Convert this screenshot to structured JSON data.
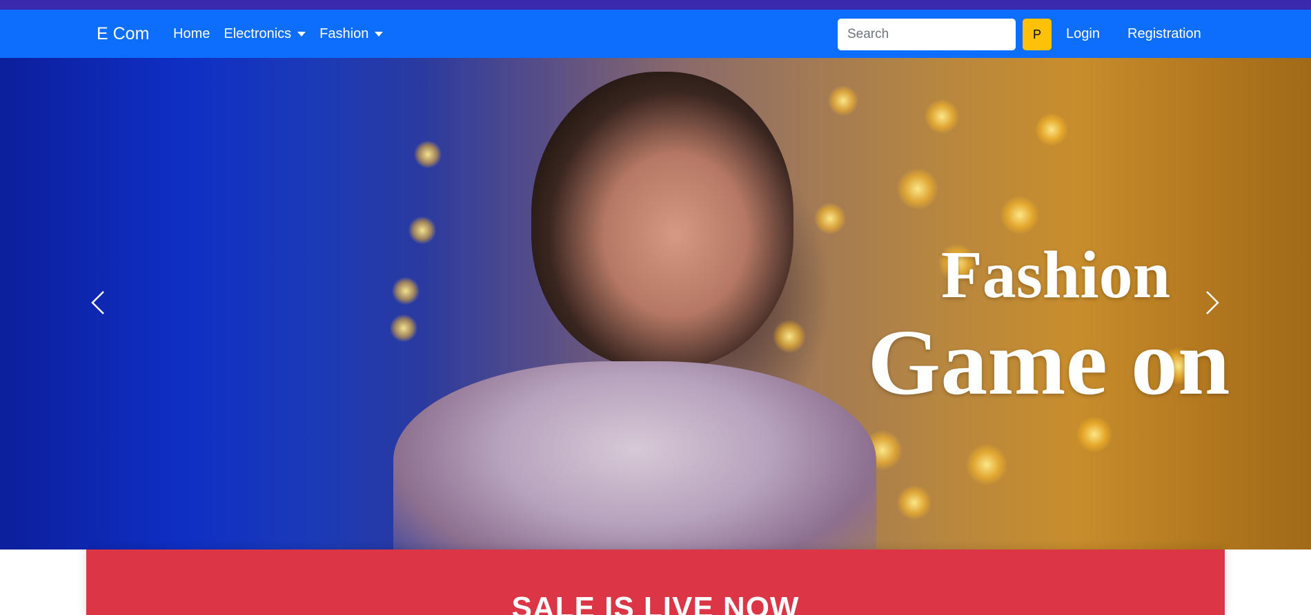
{
  "navbar": {
    "brand": "E Com",
    "links": [
      {
        "label": "Home",
        "dropdown": false
      },
      {
        "label": "Electronics",
        "dropdown": true
      },
      {
        "label": "Fashion",
        "dropdown": true
      }
    ],
    "search": {
      "placeholder": "Search",
      "value": "",
      "button_label": "P"
    },
    "login_label": "Login",
    "register_label": "Registration"
  },
  "hero": {
    "title": "Fashion",
    "subtitle": "Game on",
    "prev_icon": "chevron-left-icon",
    "next_icon": "chevron-right-icon"
  },
  "sale_banner": {
    "text": "SALE IS LIVE NOW"
  },
  "colors": {
    "top_strip": "#3a28ad",
    "navbar": "#0d6efd",
    "search_button": "#ffc107",
    "sale_banner": "#dc3545",
    "hero_text": "#ffffff"
  }
}
